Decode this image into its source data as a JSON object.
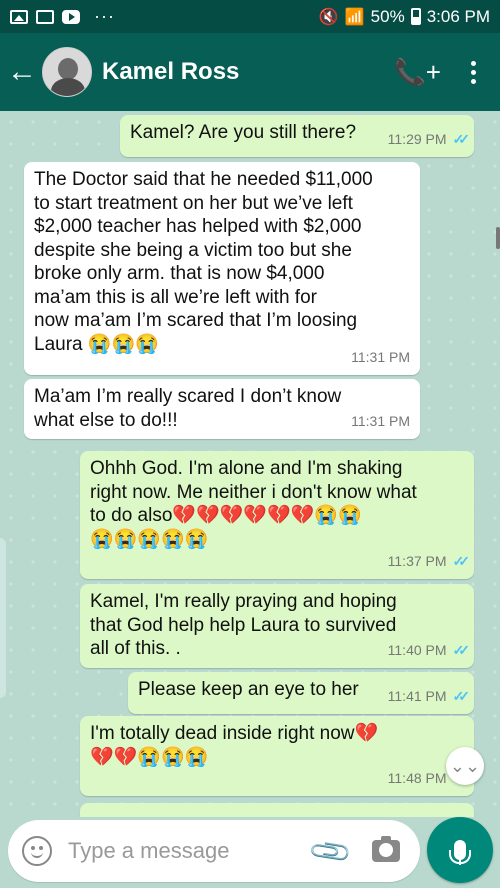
{
  "status_bar": {
    "battery": "50%",
    "time": "3:06 PM",
    "more": "···"
  },
  "header": {
    "contact_name": "Kamel Ross",
    "back": "←",
    "call_add": "📞+"
  },
  "messages": [
    {
      "dir": "out",
      "text": "Kamel? Are you still there?",
      "time": "11:29 PM",
      "ticks": "✓✓"
    },
    {
      "dir": "in",
      "text": "The Doctor said that he needed $11,000\nto start treatment on her but we’ve left\n$2,000  teacher has helped with $2,000\ndespite she being a victim too but she\nbroke only arm. that is now $4,000\nma’am this is all we’re left with for\nnow ma’am I’m scared that I’m loosing\nLaura 😭😭😭",
      "time": "11:31 PM"
    },
    {
      "dir": "in",
      "text": "Ma’am I’m really scared I don’t know\nwhat else to do!!!",
      "time": "11:31 PM"
    },
    {
      "dir": "out",
      "text": "Ohhh God. I'm alone and I'm shaking\nright now. Me neither i don't know what\nto do also💔💔💔💔💔💔😭😭\n😭😭😭😭😭",
      "time": "11:37 PM",
      "ticks": "✓✓"
    },
    {
      "dir": "out",
      "text": "Kamel, I'm really praying and hoping\nthat God help help Laura to survived\nall of this. .",
      "time": "11:40 PM",
      "ticks": "✓✓"
    },
    {
      "dir": "out",
      "text": "Please keep an eye to her",
      "time": "11:41 PM",
      "ticks": "✓✓"
    },
    {
      "dir": "out",
      "text": "I'm totally dead inside right now💔\n💔💔😭😭😭",
      "time": "11:48 PM",
      "ticks": "✓✓"
    }
  ],
  "scroll_down": "⌄⌄",
  "input": {
    "placeholder": "Type a message",
    "attach": "📎"
  }
}
